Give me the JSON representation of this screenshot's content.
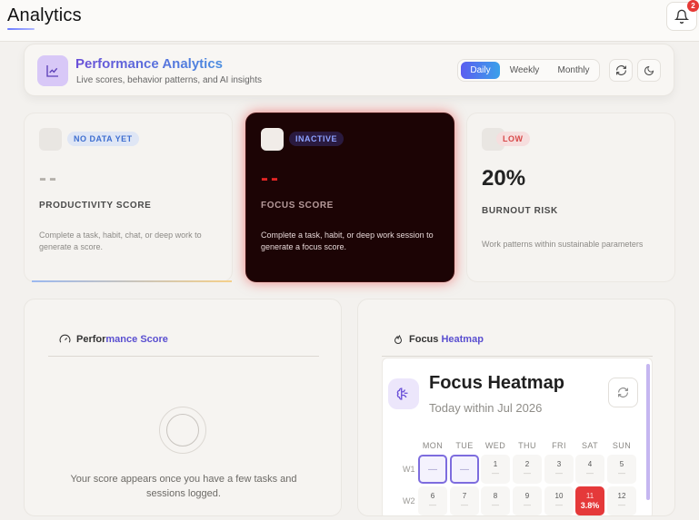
{
  "app": {
    "title": "Analytics",
    "notification_count": "2"
  },
  "header": {
    "title": "Performance Analytics",
    "subtitle": "Live scores, behavior patterns, and AI insights",
    "periods": [
      "Daily",
      "Weekly",
      "Monthly"
    ],
    "selected_period": "Daily"
  },
  "stats": [
    {
      "badge": "NO DATA YET",
      "value": "--",
      "label": "PRODUCTIVITY SCORE",
      "description": "Complete a task, habit, chat, or deep work to generate a score."
    },
    {
      "badge": "INACTIVE",
      "value": "--",
      "label": "FOCUS SCORE",
      "description": "Complete a task, habit, or deep work session to generate a focus score."
    },
    {
      "badge": "LOW",
      "value": "20%",
      "label": "BURNOUT RISK",
      "description": "Work patterns within sustainable parameters"
    }
  ],
  "performance_panel": {
    "title_plain": "Perfor",
    "title_accent": "mance Score",
    "message": "Your score appears once you have a few tasks and sessions logged."
  },
  "heatmap_panel": {
    "title_plain": "Focus ",
    "title_accent": "Heatmap",
    "card_title": "Focus Heatmap",
    "card_subtitle": "Today within Jul 2026",
    "days": [
      "MON",
      "TUE",
      "WED",
      "THU",
      "FRI",
      "SAT",
      "SUN"
    ],
    "weeks": [
      {
        "label": "W1",
        "cells": [
          {
            "num": "",
            "dash": "—",
            "state": "empty"
          },
          {
            "num": "",
            "dash": "—",
            "state": "empty"
          },
          {
            "num": "1",
            "dash": "—",
            "state": "normal"
          },
          {
            "num": "2",
            "dash": "—",
            "state": "normal"
          },
          {
            "num": "3",
            "dash": "—",
            "state": "normal"
          },
          {
            "num": "4",
            "dash": "—",
            "state": "normal"
          },
          {
            "num": "5",
            "dash": "—",
            "state": "normal"
          }
        ]
      },
      {
        "label": "W2",
        "cells": [
          {
            "num": "6",
            "dash": "—",
            "state": "normal"
          },
          {
            "num": "7",
            "dash": "—",
            "state": "normal"
          },
          {
            "num": "8",
            "dash": "—",
            "state": "normal"
          },
          {
            "num": "9",
            "dash": "—",
            "state": "normal"
          },
          {
            "num": "10",
            "dash": "—",
            "state": "normal"
          },
          {
            "num": "11",
            "dash": "3.8%",
            "state": "hot"
          },
          {
            "num": "12",
            "dash": "—",
            "state": "normal"
          }
        ]
      }
    ]
  },
  "colors": {
    "accent": "#5b5ef0",
    "danger": "#e5393a",
    "dark_card": "#1c0405"
  }
}
